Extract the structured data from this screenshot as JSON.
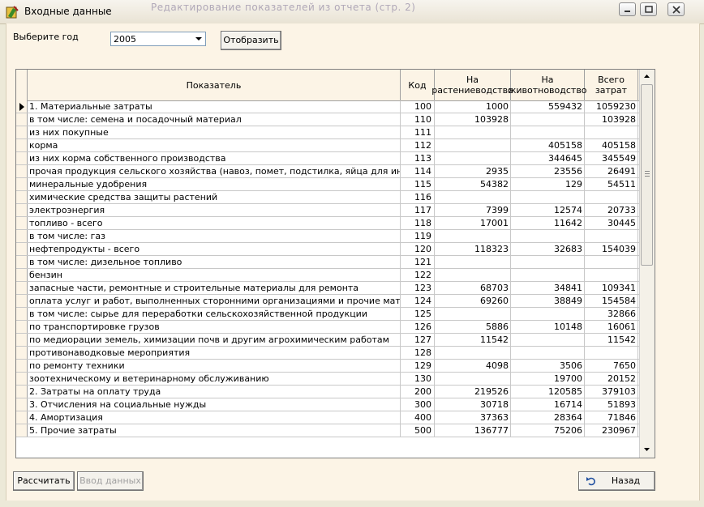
{
  "window": {
    "title": "Входные данные",
    "background_title": "Редактирование показателей из отчета (стр. 2)"
  },
  "toolbar": {
    "year_label": "Выберите год",
    "year_value": "2005",
    "show_button": "Отобразить"
  },
  "table": {
    "headers": {
      "name": "Показатель",
      "code": "Код",
      "plant": "На растениеводство",
      "animal": "На животноводство",
      "total": "Всего затрат"
    },
    "rows": [
      {
        "name": "1. Материальные затраты",
        "code": "100",
        "plant": "1000",
        "animal": "559432",
        "total": "1059230"
      },
      {
        "name": "      в том числе: семена и         посадочный материал",
        "code": "110",
        "plant": "103928",
        "animal": "",
        "total": "103928"
      },
      {
        "name": "из них  покупные",
        "code": "111",
        "plant": "",
        "animal": "",
        "total": ""
      },
      {
        "name": "корма",
        "code": "112",
        "plant": "",
        "animal": "405158",
        "total": "405158"
      },
      {
        "name": "из них корма собственного производства",
        "code": "113",
        "plant": "",
        "animal": "344645",
        "total": "345549"
      },
      {
        "name": "прочая продукция сельского хозяйства (навоз, помет, подстилка, яйца для инкубации)",
        "code": "114",
        "plant": "2935",
        "animal": "23556",
        "total": "26491"
      },
      {
        "name": "минеральные удобрения",
        "code": "115",
        "plant": "54382",
        "animal": "129",
        "total": "54511"
      },
      {
        "name": "химические средства защиты растений",
        "code": "116",
        "plant": "",
        "animal": "",
        "total": ""
      },
      {
        "name": "электроэнергия",
        "code": "117",
        "plant": "7399",
        "animal": "12574",
        "total": "20733"
      },
      {
        "name": "топливо - всего",
        "code": "118",
        "plant": "17001",
        "animal": "11642",
        "total": "30445"
      },
      {
        "name": "в том числе: газ",
        "code": "119",
        "plant": "",
        "animal": "",
        "total": ""
      },
      {
        "name": "нефтепродукты - всего",
        "code": "120",
        "plant": "118323",
        "animal": "32683",
        "total": "154039"
      },
      {
        "name": "в том числе: дизельное топливо",
        "code": "121",
        "plant": "",
        "animal": "",
        "total": ""
      },
      {
        "name": "бензин",
        "code": "122",
        "plant": "",
        "animal": "",
        "total": ""
      },
      {
        "name": "запасные части, ремонтные и строительные материалы для ремонта",
        "code": "123",
        "plant": "68703",
        "animal": "34841",
        "total": "109341"
      },
      {
        "name": "оплата услуг и работ, выполненных сторонними организациями и прочие материальные з",
        "code": "124",
        "plant": "69260",
        "animal": "38849",
        "total": "154584"
      },
      {
        "name": "в том числе: сырье для переработки сельскохозяйственной продукции",
        "code": "125",
        "plant": "",
        "animal": "",
        "total": "32866"
      },
      {
        "name": "по транспортировке грузов",
        "code": "126",
        "plant": "5886",
        "animal": "10148",
        "total": "16061"
      },
      {
        "name": "по медиорации земель, химизации почв и другим агрохимическим работам",
        "code": "127",
        "plant": "11542",
        "animal": "",
        "total": "11542"
      },
      {
        "name": "противонаводковые мероприятия",
        "code": "128",
        "plant": "",
        "animal": "",
        "total": ""
      },
      {
        "name": "по ремонту техники",
        "code": "129",
        "plant": "4098",
        "animal": "3506",
        "total": "7650"
      },
      {
        "name": "зоотехническому и ветеринарному обслуживанию",
        "code": "130",
        "plant": "",
        "animal": "19700",
        "total": "20152"
      },
      {
        "name": "2. Затраты на оплату труда",
        "code": "200",
        "plant": "219526",
        "animal": "120585",
        "total": "379103"
      },
      {
        "name": "3. Отчисления на социальные нужды",
        "code": "300",
        "plant": "30718",
        "animal": "16714",
        "total": "51893"
      },
      {
        "name": "4. Амортизация",
        "code": "400",
        "plant": "37363",
        "animal": "28364",
        "total": "71846"
      },
      {
        "name": "5. Прочие затраты",
        "code": "500",
        "plant": "136777",
        "animal": "75206",
        "total": "230967"
      }
    ]
  },
  "footer": {
    "calc_button": "Рассчитать",
    "input_button": "Ввод данных",
    "back_button": "Назад"
  }
}
